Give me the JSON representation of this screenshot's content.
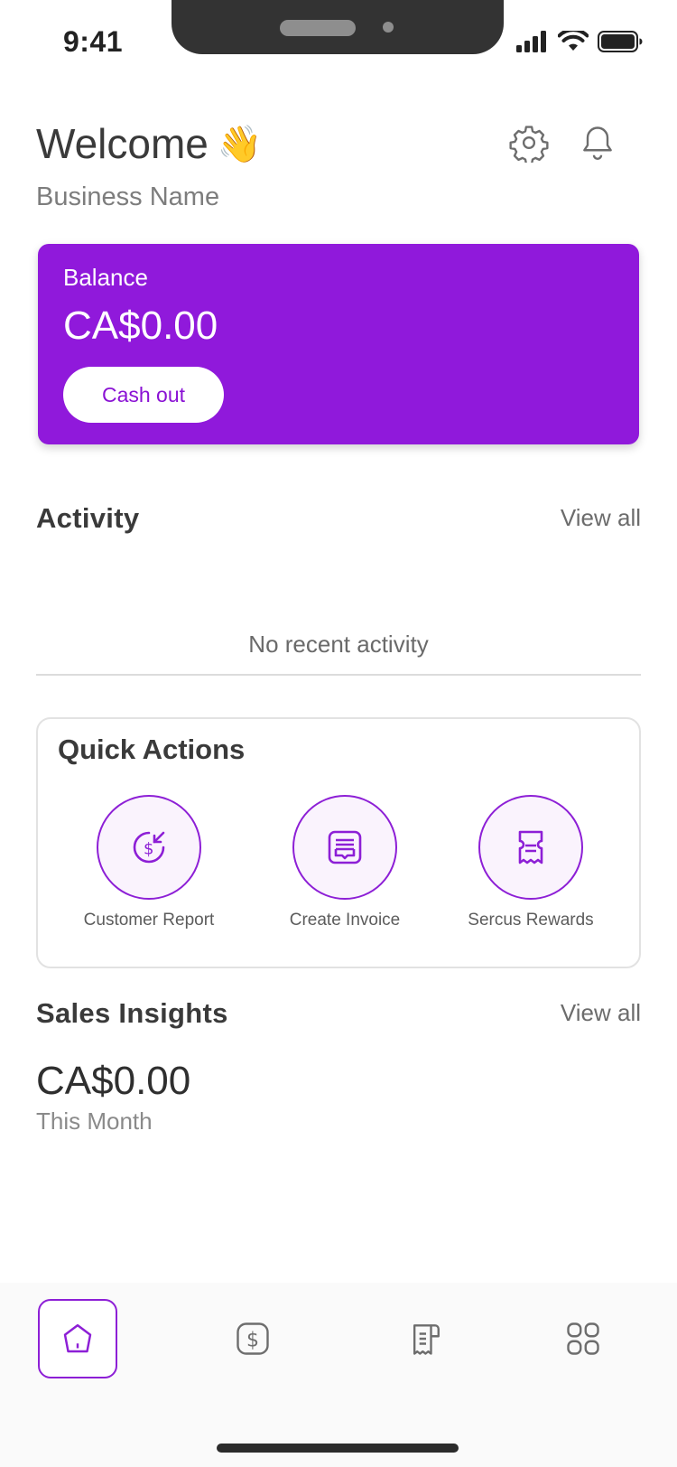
{
  "status_bar": {
    "time": "9:41"
  },
  "header": {
    "welcome": "Welcome",
    "wave_emoji": "👋",
    "business_name": "Business Name",
    "settings_icon": "gear-icon",
    "notifications_icon": "bell-icon"
  },
  "balance": {
    "label": "Balance",
    "amount": "CA$0.00",
    "cashout_label": "Cash out",
    "color": "#9019db"
  },
  "activity": {
    "title": "Activity",
    "view_all": "View all",
    "empty_text": "No recent activity"
  },
  "quick_actions": {
    "title": "Quick Actions",
    "items": [
      {
        "label": "Customer Report",
        "icon": "dollar-return-icon"
      },
      {
        "label": "Create Invoice",
        "icon": "invoice-printer-icon"
      },
      {
        "label": "Sercus Rewards",
        "icon": "receipt-icon"
      }
    ]
  },
  "sales_insights": {
    "title": "Sales Insights",
    "view_all": "View all",
    "amount": "CA$0.00",
    "period": "This Month"
  },
  "bottom_nav": {
    "items": [
      {
        "icon": "home-icon",
        "active": true
      },
      {
        "icon": "dollar-icon",
        "active": false
      },
      {
        "icon": "receipts-icon",
        "active": false
      },
      {
        "icon": "apps-grid-icon",
        "active": false
      }
    ]
  },
  "accent_color": "#8d1fd6"
}
